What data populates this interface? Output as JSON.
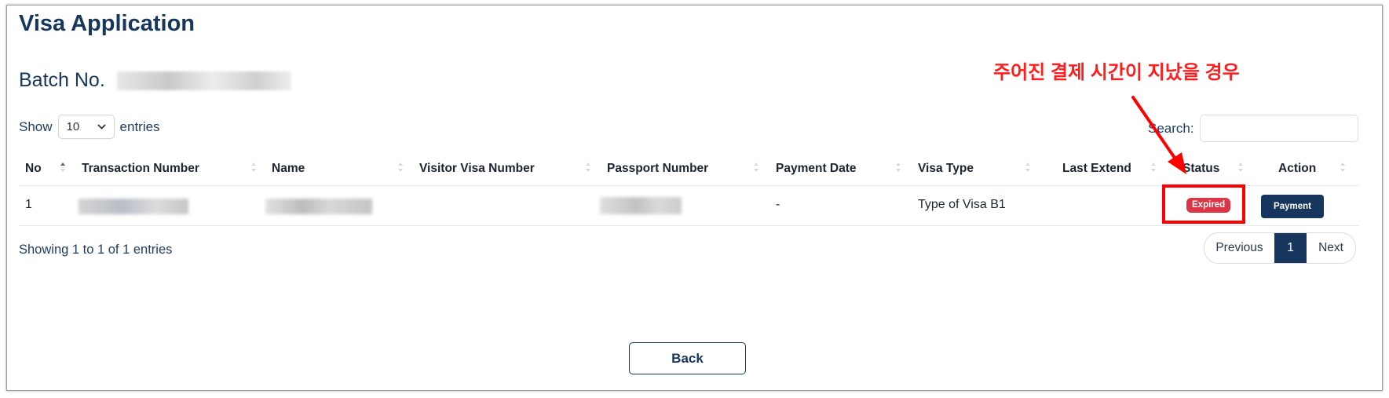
{
  "page": {
    "title": "Visa Application",
    "batch_label": "Batch No."
  },
  "length_menu": {
    "prefix": "Show",
    "value": "10",
    "suffix": "entries"
  },
  "search": {
    "label": "Search:",
    "value": ""
  },
  "table": {
    "columns": [
      "No",
      "Transaction Number",
      "Name",
      "Visitor Visa Number",
      "Passport Number",
      "Payment Date",
      "Visa Type",
      "Last Extend",
      "Status",
      "Action"
    ],
    "rows": [
      {
        "no": "1",
        "transaction_number": "",
        "name": "",
        "visitor_visa_number": "",
        "passport_number": "",
        "payment_date": "-",
        "visa_type": "Type of Visa B1",
        "last_extend": "",
        "status": "Expired",
        "action": "Payment"
      }
    ]
  },
  "footer": {
    "info": "Showing 1 to 1 of 1 entries"
  },
  "pagination": {
    "previous": "Previous",
    "current": "1",
    "next": "Next"
  },
  "back_label": "Back",
  "annotation": {
    "text": "주어진 결제 시간이 지났을 경우"
  },
  "colors": {
    "navy": "#17365d",
    "expired": "#dc3545",
    "annotation": "#ff0000"
  }
}
